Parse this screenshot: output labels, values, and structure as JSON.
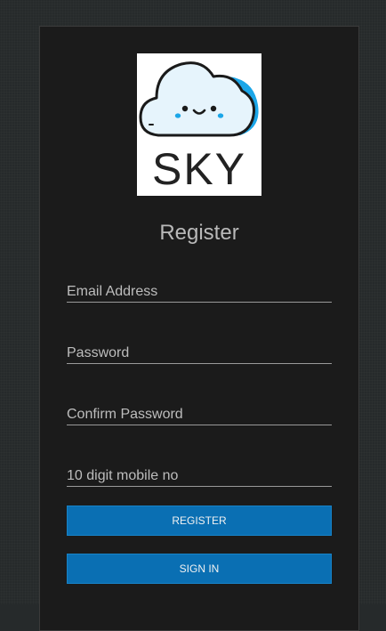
{
  "logo": {
    "text": "SKY",
    "icon": "cloud-face-icon",
    "colors": {
      "cloud": "#d9eefb",
      "cloud_accent": "#1ba6e8",
      "outline": "#1a1a1a"
    }
  },
  "form": {
    "title": "Register",
    "fields": {
      "email": {
        "placeholder": "Email Address",
        "value": ""
      },
      "password": {
        "placeholder": "Password",
        "value": ""
      },
      "confirm": {
        "placeholder": "Confirm Password",
        "value": ""
      },
      "mobile": {
        "placeholder": "10 digit mobile no",
        "value": ""
      }
    },
    "register_label": "REGISTER",
    "signin_label": "SIGN IN"
  },
  "colors": {
    "background": "#262a2b",
    "card": "#1b1b1b",
    "button": "#0a6fb3"
  }
}
